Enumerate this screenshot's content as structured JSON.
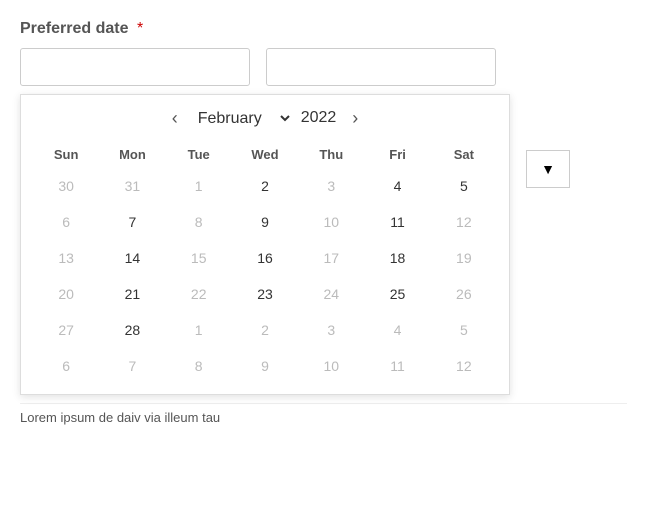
{
  "form": {
    "label": "Preferred date",
    "required": true,
    "required_marker": "*",
    "date_placeholder": "",
    "time_placeholder": ""
  },
  "calendar": {
    "month_label": "February",
    "year_label": "2022",
    "prev_nav": "‹",
    "next_nav": "›",
    "day_headers": [
      "Sun",
      "Mon",
      "Tue",
      "Wed",
      "Thu",
      "Fri",
      "Sat"
    ],
    "weeks": [
      [
        {
          "label": "30",
          "other": true
        },
        {
          "label": "31",
          "other": true
        },
        {
          "label": "1",
          "other": true
        },
        {
          "label": "2",
          "other": false
        },
        {
          "label": "3",
          "other": true
        },
        {
          "label": "4",
          "other": false
        },
        {
          "label": "5",
          "other": false
        }
      ],
      [
        {
          "label": "6",
          "other": true
        },
        {
          "label": "7",
          "other": false
        },
        {
          "label": "8",
          "other": true
        },
        {
          "label": "9",
          "other": false
        },
        {
          "label": "10",
          "other": true
        },
        {
          "label": "11",
          "other": false
        },
        {
          "label": "12",
          "other": true
        }
      ],
      [
        {
          "label": "13",
          "other": true
        },
        {
          "label": "14",
          "other": false
        },
        {
          "label": "15",
          "other": true
        },
        {
          "label": "16",
          "other": false
        },
        {
          "label": "17",
          "other": true
        },
        {
          "label": "18",
          "other": false
        },
        {
          "label": "19",
          "other": true
        }
      ],
      [
        {
          "label": "20",
          "other": true
        },
        {
          "label": "21",
          "other": false
        },
        {
          "label": "22",
          "other": true
        },
        {
          "label": "23",
          "other": false
        },
        {
          "label": "24",
          "other": true
        },
        {
          "label": "25",
          "other": false
        },
        {
          "label": "26",
          "other": true
        }
      ],
      [
        {
          "label": "27",
          "other": true
        },
        {
          "label": "28",
          "other": false
        },
        {
          "label": "1",
          "other": true
        },
        {
          "label": "2",
          "other": true
        },
        {
          "label": "3",
          "other": true
        },
        {
          "label": "4",
          "other": true
        },
        {
          "label": "5",
          "other": true
        }
      ],
      [
        {
          "label": "6",
          "other": true
        },
        {
          "label": "7",
          "other": true
        },
        {
          "label": "8",
          "other": true
        },
        {
          "label": "9",
          "other": true
        },
        {
          "label": "10",
          "other": true
        },
        {
          "label": "11",
          "other": true
        },
        {
          "label": "12",
          "other": true
        }
      ]
    ]
  },
  "time": {
    "dropdown_arrow": "▼"
  },
  "bottom_text": "Lorem ipsum de daiv via illeum tau"
}
